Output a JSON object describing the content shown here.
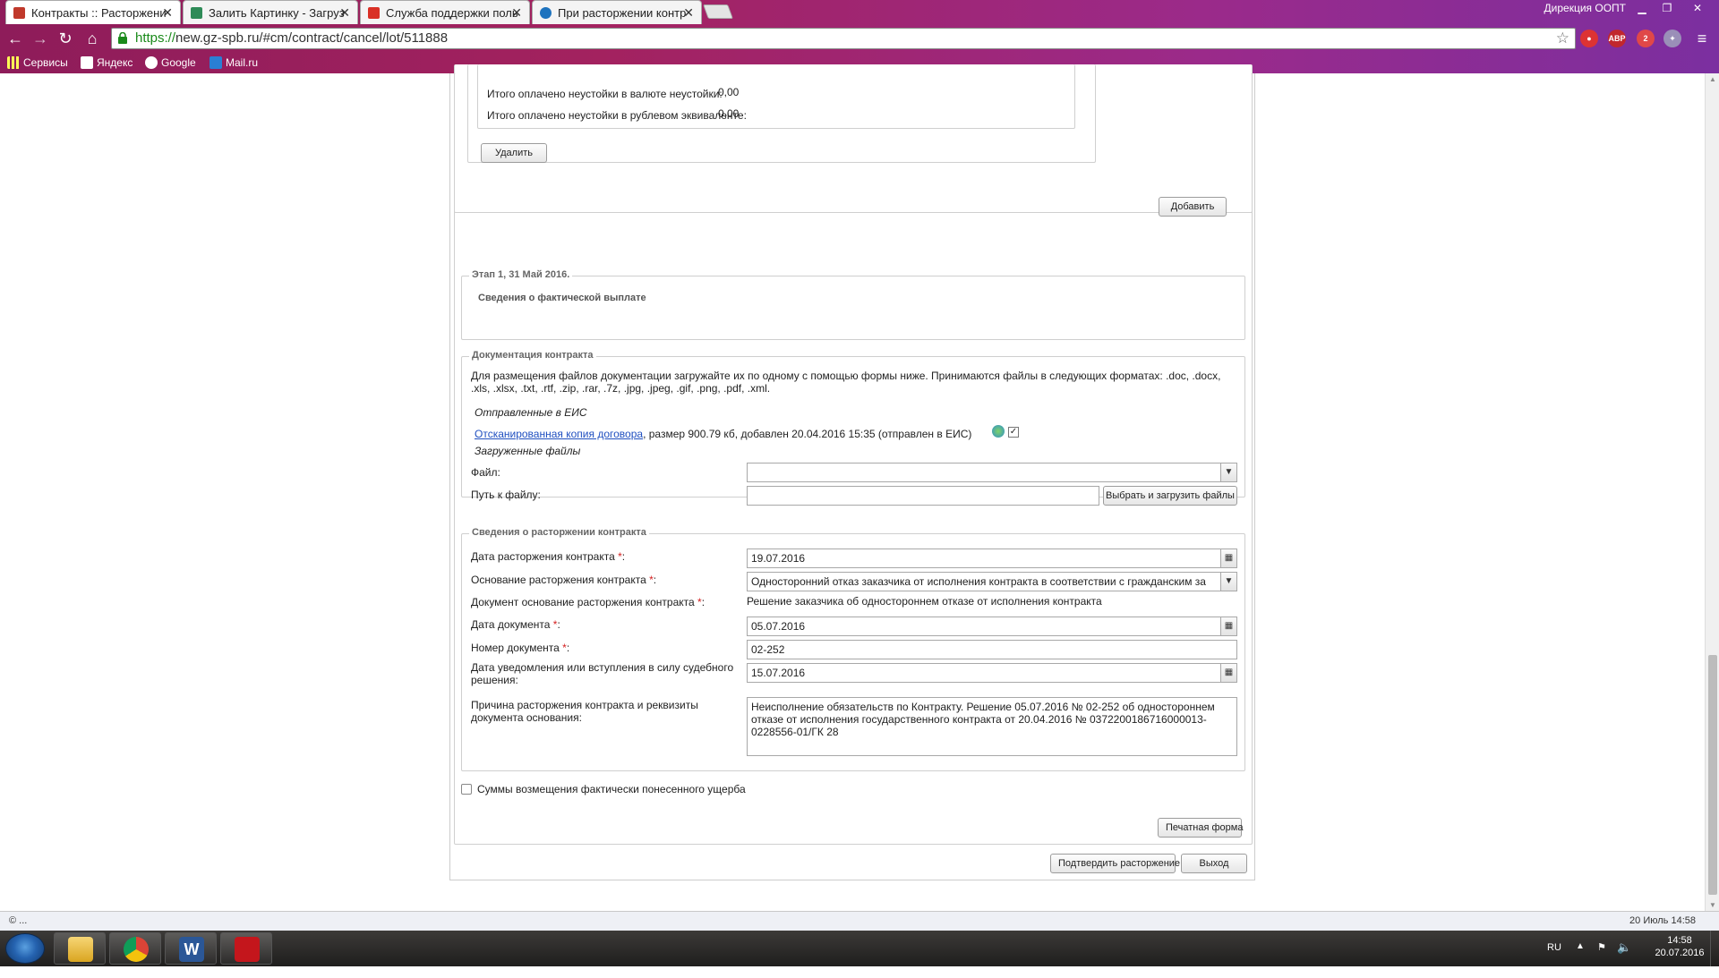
{
  "browser": {
    "tabs": [
      {
        "title": "Контракты :: Расторжени",
        "active": true,
        "favicon_color": "#c0392b"
      },
      {
        "title": "Залить Картинку - Загруз",
        "active": false,
        "favicon_color": "#2e8b57"
      },
      {
        "title": "Служба поддержки поль",
        "active": false,
        "favicon_color": "#d93025"
      },
      {
        "title": "При расторжении контр",
        "active": false,
        "favicon_color": "#1e73be"
      }
    ],
    "profile_name": "Дирекция ООПТ",
    "url_scheme": "https://",
    "url_rest": "new.gz-spb.ru/#cm/contract/cancel/lot/511888",
    "bookmarks": [
      "Сервисы",
      "Яндекс",
      "Google",
      "Mail.ru"
    ],
    "extensions": [
      "ABP"
    ],
    "notification_badge": "2"
  },
  "penalty": {
    "paid_currency_label": "Итого оплачено неустойки в валюте неустойки:",
    "paid_currency_value": "0,00",
    "paid_rub_label": "Итого оплачено неустойки в рублевом эквиваленте:",
    "paid_rub_value": "0,00",
    "delete_label": "Удалить",
    "add_label": "Добавить"
  },
  "stage": {
    "legend": "Этап 1, 31 Май 2016.",
    "subtitle": "Сведения о фактической выплате"
  },
  "docs": {
    "legend": "Документация контракта",
    "instructions": "Для размещения файлов документации загружайте их по одному с помощью формы ниже. Принимаются файлы в следующих форматах: .doc, .docx, .xls, .xlsx, .txt, .rtf, .zip, .rar, .7z, .jpg, .jpeg, .gif, .png, .pdf, .xml.",
    "sent_heading": "Отправленные в ЕИС",
    "file_link": "Отсканированная копия договора",
    "file_meta": ", размер 900.79 кб, добавлен 20.04.2016 15:35 (отправлен в ЕИС)",
    "uploaded_heading": "Загруженные файлы",
    "file_label": "Файл:",
    "path_label": "Путь к файлу:",
    "upload_button": "Выбрать и загрузить файлы"
  },
  "termination": {
    "legend": "Сведения о расторжении контракта",
    "date_label": "Дата расторжения контракта",
    "date_value": "19.07.2016",
    "basis_label": "Основание расторжения контракта",
    "basis_value": "Односторонний отказ заказчика от исполнения контракта в соответствии с гражданским за",
    "doc_basis_label": "Документ основание расторжения контракта",
    "doc_basis_value": "Решение заказчика об одностороннем отказе от исполнения контракта",
    "doc_date_label": "Дата документа",
    "doc_date_value": "05.07.2016",
    "doc_number_label": "Номер документа",
    "doc_number_value": "02-252",
    "notice_date_label_1": "Дата уведомления или вступления в силу судебного",
    "notice_date_label_2": "решения:",
    "notice_date_value": "15.07.2016",
    "reason_label_1": "Причина расторжения контракта и реквизиты",
    "reason_label_2": "документа основания:",
    "reason_value": "Неисполнение обязательств по Контракту. Решение 05.07.2016 № 02-252 об одностороннем отказе от исполнения государственного контракта от 20.04.2016 № 0372200186716000013-0228556-01/ГК 28",
    "required_mark": "*",
    "colon": ":"
  },
  "damages_checkbox_label": "Суммы возмещения фактически понесенного ущерба",
  "print_button": "Печатная форма",
  "confirm_button": "Подтвердить расторжение",
  "exit_button": "Выход",
  "statusbar": {
    "left": "© ...",
    "right": "20 Июль 14:58"
  },
  "taskbar": {
    "lang": "RU",
    "time": "14:58",
    "date": "20.07.2016",
    "word_glyph": "W"
  }
}
